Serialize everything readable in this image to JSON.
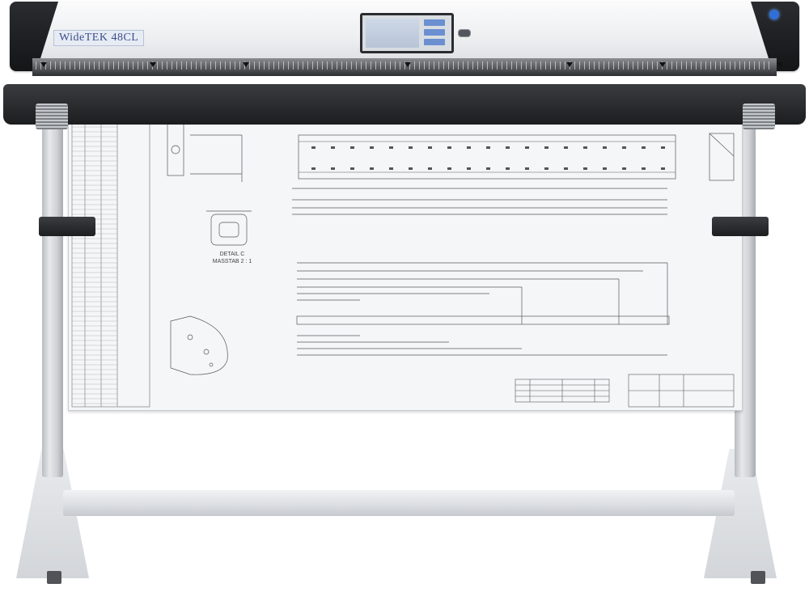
{
  "scanner": {
    "brand_text": "WideTEK 48CL"
  },
  "drawing": {
    "detail_c_title": "DETAIL C",
    "detail_c_scale": "MASSTAB 2 : 1"
  },
  "colors": {
    "scanner_body": "#eceef0",
    "scanner_caps": "#1c1d1f",
    "stand": "#d7dadd",
    "sheet": "#f5f6f7",
    "power_led": "#2f6fd6"
  }
}
